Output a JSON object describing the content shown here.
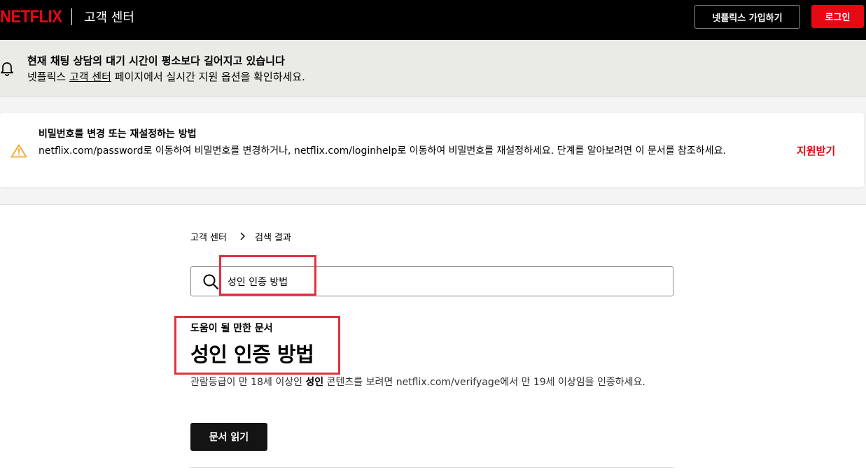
{
  "header": {
    "logo": "NETFLIX",
    "title": "고객 센터",
    "signup_label": "넷플릭스 가입하기",
    "login_label": "로그인"
  },
  "notice": {
    "icon": "bell-icon",
    "title": "현재 채팅 상담의 대기 시간이 평소보다 길어지고 있습니다",
    "sub_prefix": "넷플릭스 ",
    "sub_link": "고객 센터",
    "sub_suffix": " 페이지에서 실시간 지원 옵션을 확인하세요."
  },
  "alert": {
    "icon": "warning-icon",
    "title": "비밀번호를 변경 또는 재설정하는 방법",
    "body": "netflix.com/password로 이동하여 비밀번호를 변경하거나, netflix.com/loginhelp로 이동하여 비밀번호를 재설정하세요. 단계를 알아보려면 이 문서를 참조하세요.",
    "link_label": "지원받기"
  },
  "breadcrumb": {
    "items": [
      "고객 센터",
      "검색 결과"
    ]
  },
  "search": {
    "value": "성인 인증 방법",
    "placeholder": ""
  },
  "result": {
    "section_label": "도움이 될 만한 문서",
    "title": "성인 인증 방법",
    "desc_prefix": "관람등급이 만 18세 이상인 ",
    "desc_bold": "성인",
    "desc_suffix": " 콘텐츠를 보려면 netflix.com/verifyage에서 만 19세 이상임을 인증하세요.",
    "button_label": "문서 읽기"
  },
  "colors": {
    "brand": "#e50914",
    "highlight": "#e3303f",
    "warning": "#f5a623"
  }
}
